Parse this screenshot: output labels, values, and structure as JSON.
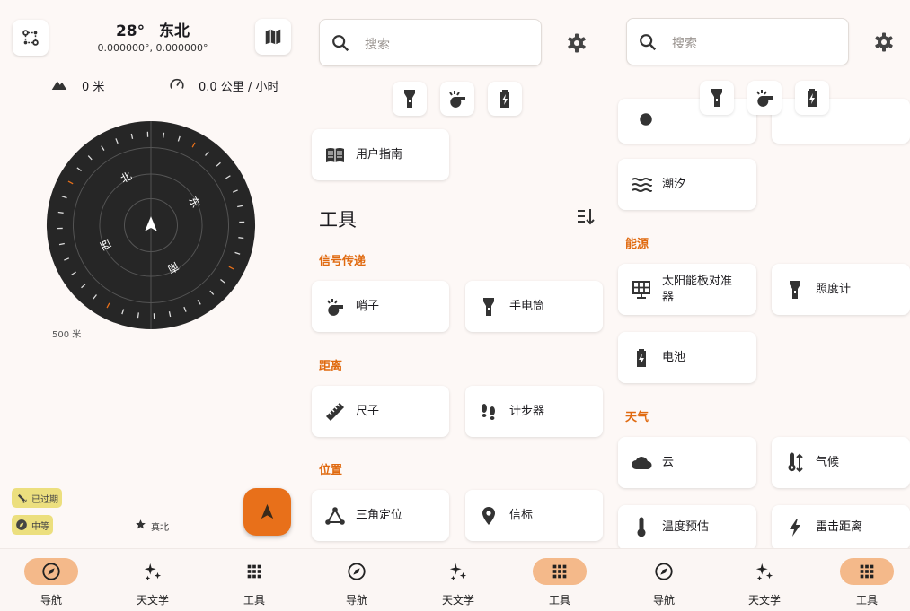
{
  "colors": {
    "accent": "#e8701a",
    "accent_light": "#f4b98a",
    "compass_bg": "#262626",
    "section": "#e06a10",
    "chip": "#ecdf7e"
  },
  "nav": {
    "heading": "28°",
    "direction": "东北",
    "coords": "0.000000°, 0.000000°",
    "altitude": "0 米",
    "speed": "0.0 公里 / 小时",
    "compass": {
      "n": "北",
      "e": "东",
      "s": "南",
      "w": "西"
    },
    "scale": "500 米",
    "gps_badge": "已过期",
    "accuracy_badge": "中等",
    "true_north": "真北"
  },
  "bottom_nav": {
    "navigation": "导航",
    "astronomy": "天文学",
    "tools": "工具"
  },
  "tools": {
    "search_placeholder": "搜索",
    "user_guide": "用户指南",
    "title": "工具",
    "sections": {
      "signal": "信号传递",
      "distance": "距离",
      "location": "位置"
    },
    "items": {
      "whistle": "哨子",
      "flashlight": "手电筒",
      "ruler": "尺子",
      "pedometer": "计步器",
      "triangulate": "三角定位",
      "beacons": "信标"
    }
  },
  "tools2": {
    "search_placeholder": "搜索",
    "tides": "潮汐",
    "sections": {
      "power": "能源",
      "weather": "天气"
    },
    "items": {
      "solar_panel": "太阳能板对准器",
      "light_meter": "照度计",
      "battery": "电池",
      "clouds": "云",
      "climate": "气候",
      "temperature_estimation": "温度预估",
      "lightning": "雷击距离"
    }
  }
}
